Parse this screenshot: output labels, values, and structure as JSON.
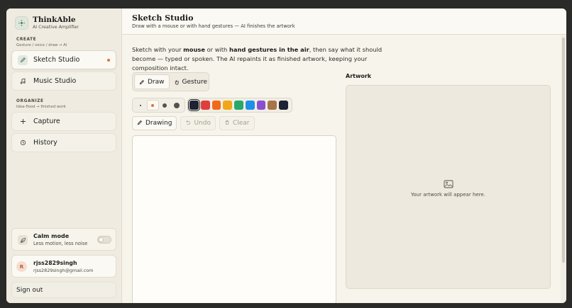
{
  "brand": {
    "name": "ThinkAble",
    "tagline": "AI Creative Amplifier"
  },
  "sidebar": {
    "create_label": "CREATE",
    "create_sub": "Gesture / voice / draw → AI",
    "items": [
      {
        "label": "Sketch Studio",
        "icon": "pencil-icon",
        "active": true
      },
      {
        "label": "Music Studio",
        "icon": "music-note-icon",
        "active": false
      }
    ],
    "organize_label": "ORGANIZE",
    "organize_sub": "Idea-flood → finished work",
    "organize_items": [
      {
        "label": "Capture",
        "icon": "plus-icon"
      },
      {
        "label": "History",
        "icon": "history-icon"
      }
    ],
    "calm_mode": {
      "title": "Calm mode",
      "subtitle": "Less motion, less noise",
      "enabled": false
    },
    "user": {
      "initial": "R",
      "name": "rjss2829singh",
      "email": "rjss2829singh@gmail.com"
    },
    "signout_label": "Sign out"
  },
  "header": {
    "title": "Sketch Studio",
    "subtitle": "Draw with a mouse or with hand gestures — AI finishes the artwork"
  },
  "intro": {
    "p1": "Sketch with your ",
    "b1": "mouse",
    "p2": " or with ",
    "b2": "hand gestures in the air",
    "p3": ", then say what it should become — typed or spoken. The AI repaints it as finished artwork, keeping your composition intact."
  },
  "modes": [
    {
      "label": "Draw",
      "icon": "pencil-icon",
      "selected": true
    },
    {
      "label": "Gesture",
      "icon": "hand-icon",
      "selected": false
    }
  ],
  "brush_sizes": {
    "selected_index": 1,
    "accent": "#e0703a"
  },
  "palette": {
    "colors": [
      "#1d2333",
      "#e03e3e",
      "#f06a1a",
      "#f0a818",
      "#2aa86a",
      "#1e90e8",
      "#8a4fd0",
      "#a8744a",
      "#1d2333"
    ],
    "selected_index": 0
  },
  "actions": {
    "drawing": "Drawing",
    "undo": "Undo",
    "clear": "Clear"
  },
  "artwork": {
    "label": "Artwork",
    "placeholder": "Your artwork will appear here."
  }
}
